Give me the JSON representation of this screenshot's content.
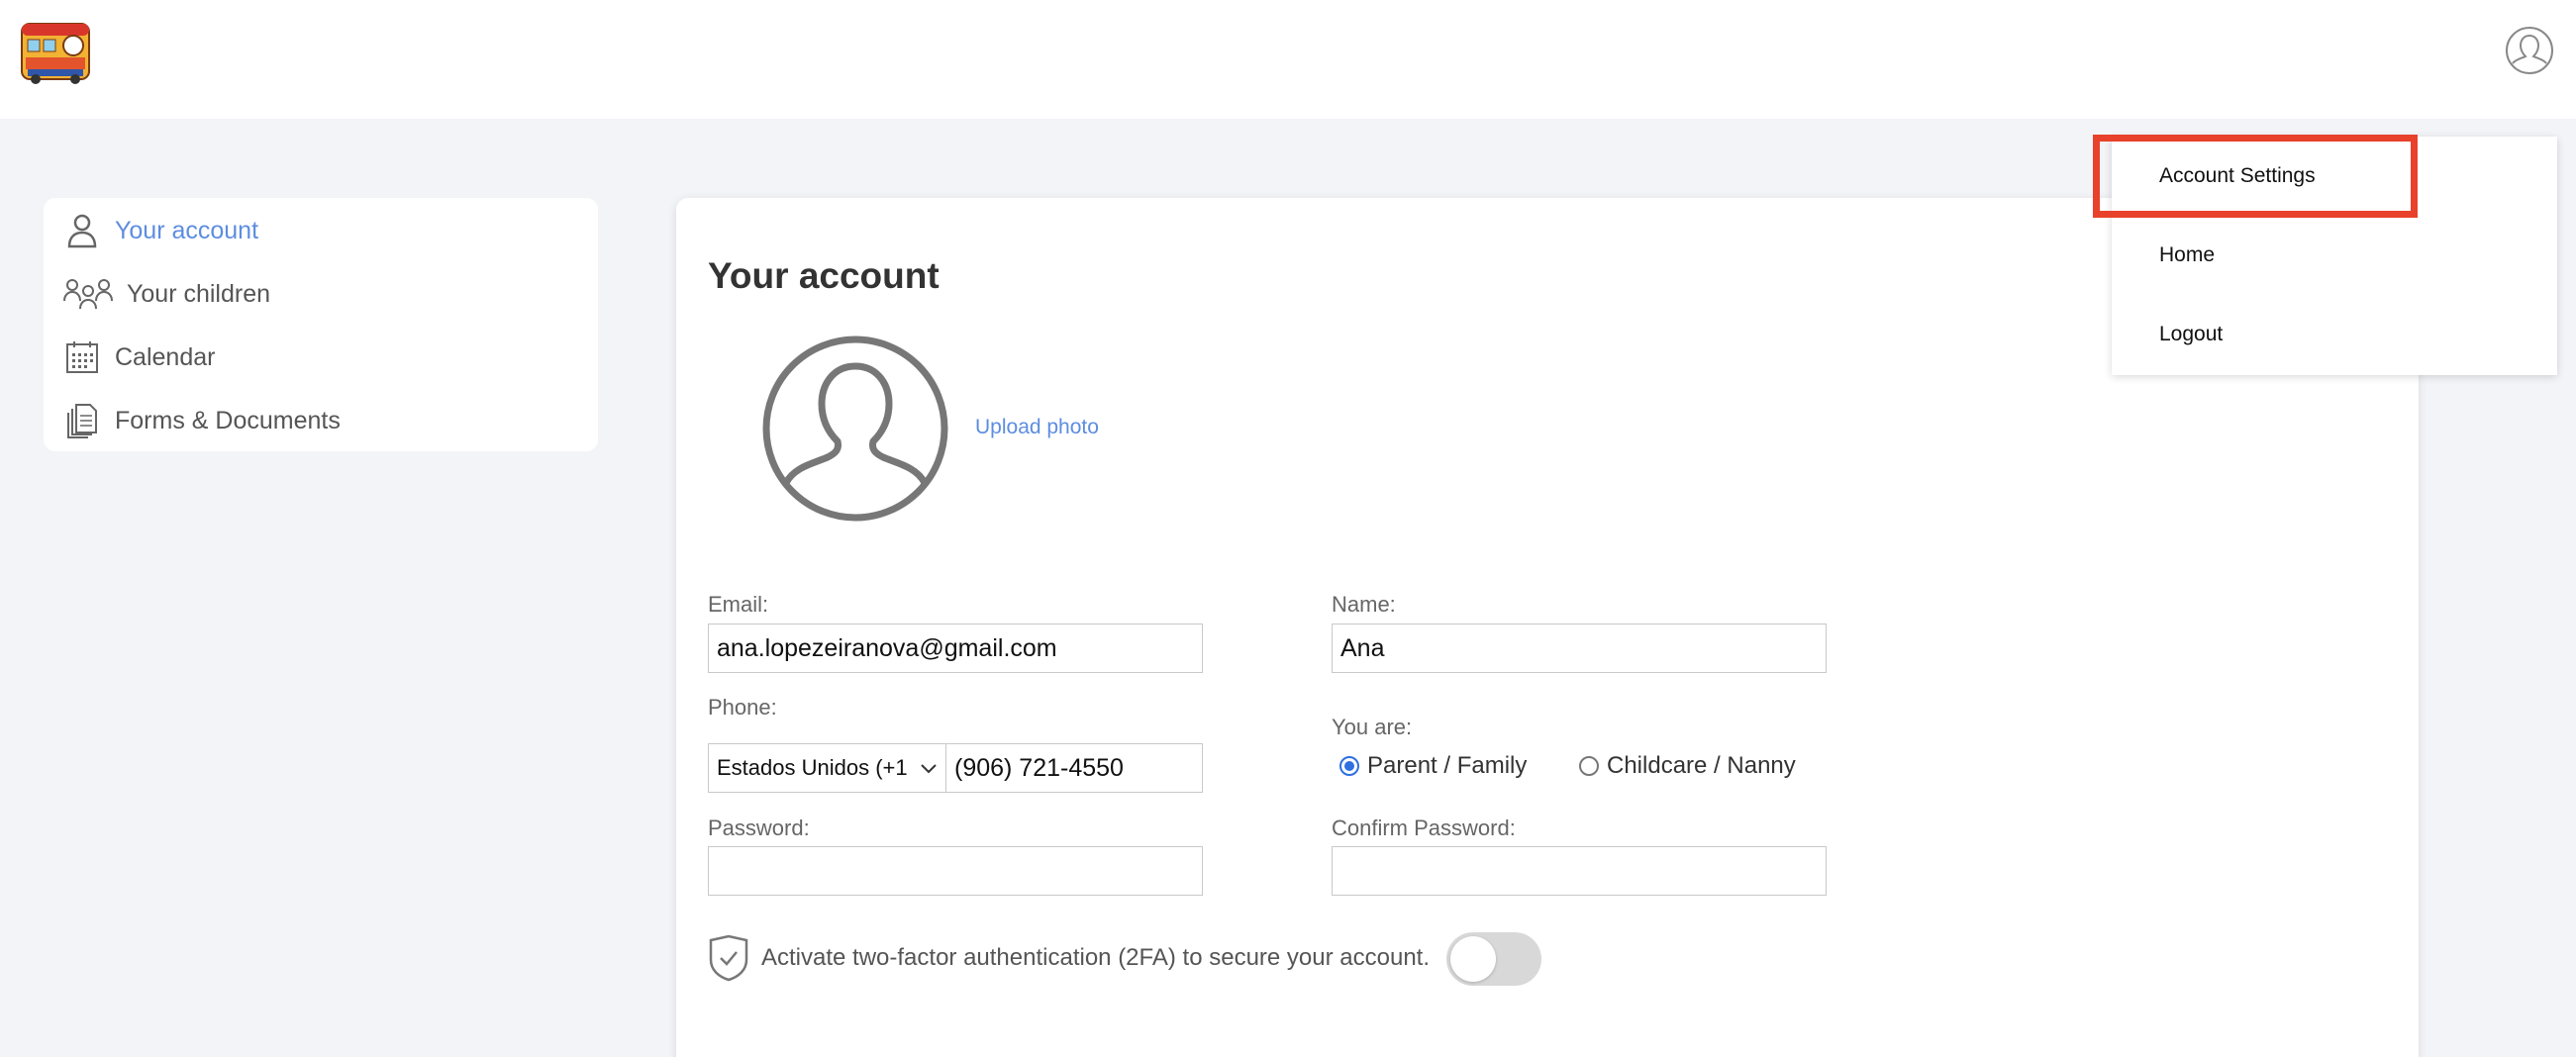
{
  "header": {
    "logo_icon": "magic-bus-logo",
    "user_icon": "user-circle-icon"
  },
  "sidebar": {
    "items": [
      {
        "label": "Your account",
        "icon": "person-icon",
        "active": true
      },
      {
        "label": "Your children",
        "icon": "people-group-icon",
        "active": false
      },
      {
        "label": "Calendar",
        "icon": "calendar-icon",
        "active": false
      },
      {
        "label": "Forms & Documents",
        "icon": "documents-icon",
        "active": false
      }
    ]
  },
  "account": {
    "title": "Your account",
    "upload_label": "Upload photo",
    "email_label": "Email:",
    "email_value": "ana.lopezeiranova@gmail.com",
    "name_label": "Name:",
    "name_value": "Ana",
    "phone_label": "Phone:",
    "phone_country": "Estados Unidos (+1",
    "phone_value": "(906) 721-4550",
    "you_are_label": "You are:",
    "role_options": [
      "Parent / Family",
      "Childcare / Nanny"
    ],
    "role_selected": "Parent / Family",
    "password_label": "Password:",
    "password_value": "",
    "confirm_label": "Confirm Password:",
    "confirm_value": "",
    "tfa_text": "Activate two-factor authentication (2FA) to secure your account.",
    "tfa_enabled": false
  },
  "menu": {
    "items": [
      "Account Settings",
      "Home",
      "Logout"
    ],
    "highlighted": "Account Settings"
  },
  "colors": {
    "accent": "#5d8de0",
    "highlight_border": "#e8412c",
    "background": "#f3f4f8"
  }
}
